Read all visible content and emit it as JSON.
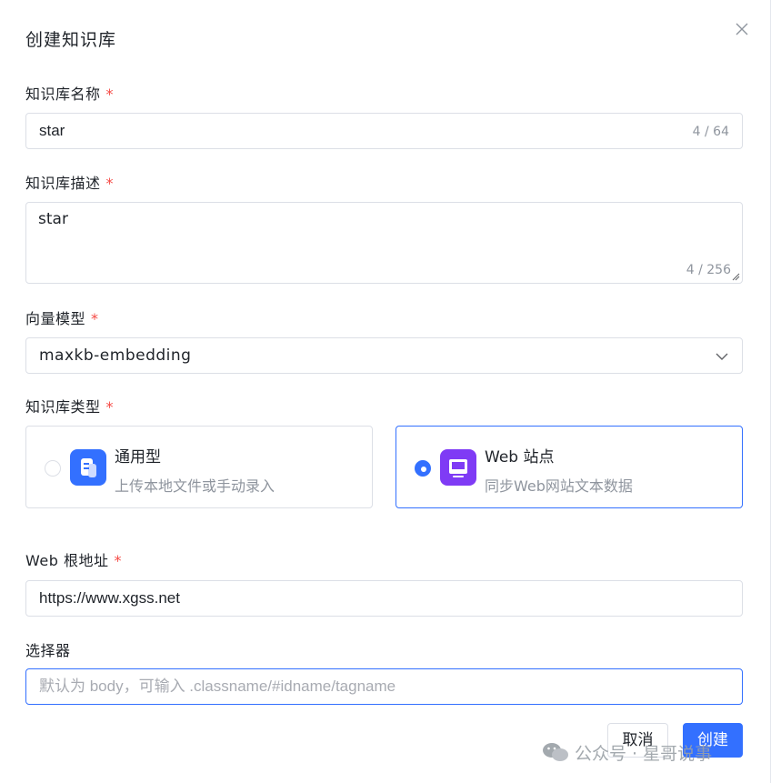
{
  "dialog": {
    "title": "创建知识库",
    "close_icon": "close-icon"
  },
  "fields": {
    "name": {
      "label": "知识库名称",
      "required": "*",
      "value": "star",
      "counter": "4 / 64"
    },
    "description": {
      "label": "知识库描述",
      "required": "*",
      "value": "star",
      "counter": "4 / 256"
    },
    "model": {
      "label": "向量模型",
      "required": "*",
      "value": "maxkb-embedding"
    },
    "type": {
      "label": "知识库类型",
      "required": "*",
      "options": [
        {
          "title": "通用型",
          "desc": "上传本地文件或手动录入",
          "icon": "document-icon",
          "selected": false
        },
        {
          "title": "Web 站点",
          "desc": "同步Web网站文本数据",
          "icon": "monitor-icon",
          "selected": true
        }
      ]
    },
    "web_root": {
      "label": "Web 根地址",
      "required": "*",
      "value": "https://www.xgss.net"
    },
    "selector": {
      "label": "选择器",
      "placeholder": "默认为 body，可输入 .classname/#idname/tagname"
    }
  },
  "buttons": {
    "cancel": "取消",
    "create": "创建"
  },
  "watermark": "公众号 · 星哥说事",
  "colors": {
    "primary": "#3370ff",
    "required": "#f54a45",
    "general_tile": "#3370ff",
    "web_tile": "#7f3bf5"
  }
}
